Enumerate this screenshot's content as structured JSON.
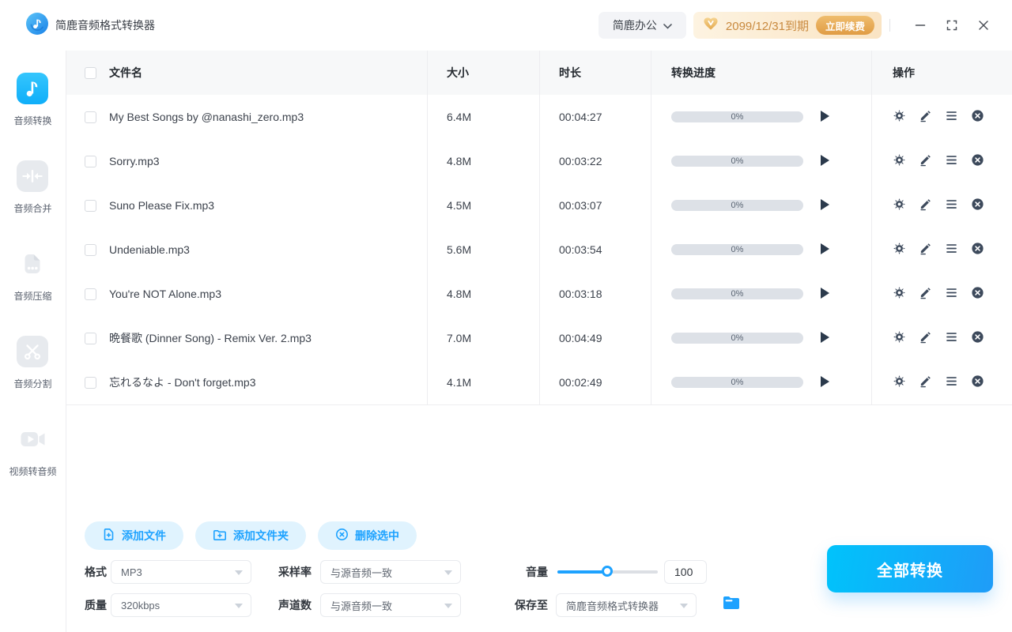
{
  "titlebar": {
    "app_title": "简鹿音频格式转换器",
    "suite_button": "简鹿办公",
    "license_text": "2099/12/31到期",
    "renew_button": "立即续费"
  },
  "sidebar": {
    "items": [
      {
        "label": "音频转换",
        "icon": "music-note-icon",
        "active": true
      },
      {
        "label": "音频合并",
        "icon": "merge-arrows-icon",
        "active": false
      },
      {
        "label": "音频压缩",
        "icon": "compress-file-icon",
        "active": false
      },
      {
        "label": "音频分割",
        "icon": "scissors-icon",
        "active": false
      },
      {
        "label": "视频转音频",
        "icon": "video-camera-icon",
        "active": false
      }
    ]
  },
  "table": {
    "headers": {
      "filename": "文件名",
      "size": "大小",
      "duration": "时长",
      "progress": "转换进度",
      "actions": "操作"
    },
    "rows": [
      {
        "filename": "My Best Songs by @nanashi_zero.mp3",
        "size": "6.4M",
        "duration": "00:04:27",
        "progress": "0%"
      },
      {
        "filename": "Sorry.mp3",
        "size": "4.8M",
        "duration": "00:03:22",
        "progress": "0%"
      },
      {
        "filename": "Suno Please Fix.mp3",
        "size": "4.5M",
        "duration": "00:03:07",
        "progress": "0%"
      },
      {
        "filename": "Undeniable.mp3",
        "size": "5.6M",
        "duration": "00:03:54",
        "progress": "0%"
      },
      {
        "filename": "You're NOT Alone.mp3",
        "size": "4.8M",
        "duration": "00:03:18",
        "progress": "0%"
      },
      {
        "filename": "晩餐歌 (Dinner Song) - Remix Ver. 2.mp3",
        "size": "7.0M",
        "duration": "00:04:49",
        "progress": "0%"
      },
      {
        "filename": "忘れるなよ - Don't forget.mp3",
        "size": "4.1M",
        "duration": "00:02:49",
        "progress": "0%"
      }
    ],
    "row_action_icons": [
      "gear-icon",
      "edit-pencil-icon",
      "list-icon",
      "remove-circle-icon"
    ],
    "row_play_icon": "play-icon"
  },
  "toolbar": {
    "add_file": "添加文件",
    "add_folder": "添加文件夹",
    "delete_selected": "删除选中"
  },
  "settings": {
    "format_label": "格式",
    "format_value": "MP3",
    "sample_rate_label": "采样率",
    "sample_rate_value": "与源音频一致",
    "volume_label": "音量",
    "volume_value": "100",
    "volume_fill_percent": 50,
    "quality_label": "质量",
    "quality_value": "320kbps",
    "channels_label": "声道数",
    "channels_value": "与源音频一致",
    "save_to_label": "保存至",
    "save_to_value": "简鹿音频格式转换器"
  },
  "convert_all": {
    "label": "全部转换"
  },
  "colors": {
    "accent": "#1da2ff",
    "sidebar_active_icon": "#1eb9fc",
    "inactive_icon": "#e7eaee",
    "action_icon": "#3d4a5c",
    "renew_orange": "#e09c44",
    "license_text": "#c98a3f",
    "convert_gradient_start": "#00c3fb",
    "convert_gradient_end": "#1f9cf8",
    "progress_track": "#dde1e7",
    "toolbar_button_bg": "#e0f3fe"
  }
}
